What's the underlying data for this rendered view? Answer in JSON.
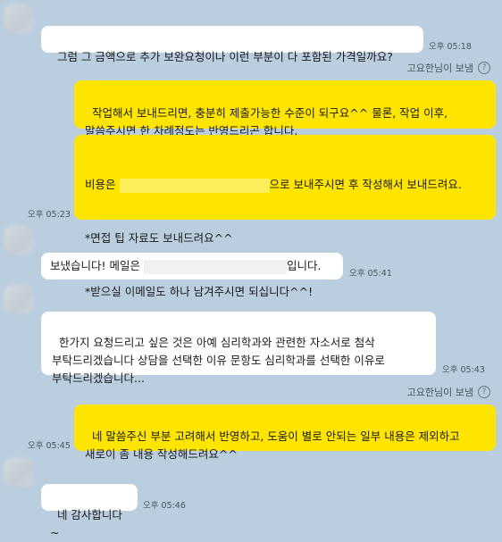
{
  "messages": {
    "m1": {
      "text": "그럼 그 금액으로 추가 보완요청이나 이런 부분이 다 포함된 가격일까요?",
      "time": "오후 05:18"
    },
    "m2_sender": {
      "name": "고요한님이 보냄",
      "icon": "?"
    },
    "m2": {
      "text": "작업해서 보내드리면, 충분히 제출가능한 수준이 되구요^^ 물론, 작업 이후, 말씀주시면 한 차례정도는 반영드리곤 합니다."
    },
    "m3": {
      "prefix": "비용은",
      "suffix": "으로 보내주시면 후 작성해서 보내드려요.",
      "line2": "*면접 팁 자료도 보내드려요^^",
      "line3": "*받으실 이메일도 하나 남겨주시면 되십니다^^!",
      "time": "오후 05:23"
    },
    "m4": {
      "prefix": "보냈습니다! 메일은",
      "suffix": "입니다.",
      "time": "오후 05:41"
    },
    "m5": {
      "text": "한가지 요청드리고 싶은 것은 아예 심리학과와 관련한 자소서로 첨삭 부탁드리겠습니다 상담을 선택한 이유 문항도 심리학과를 선택한 이유로 부탁드리겠습니다...",
      "time": "오후 05:43"
    },
    "m6_sender": {
      "name": "고요한님이 보냄",
      "icon": "?"
    },
    "m6": {
      "text": "네 말씀주신 부분 고려해서 반영하고, 도움이 별로 안되는 일부 내용은 제외하고 새로이 좀 내용 작성해드려요^^",
      "time": "오후 05:45"
    },
    "m7": {
      "text": "네 감사합니다~",
      "time": "오후 05:46"
    }
  },
  "colors": {
    "background": "#bacee0",
    "outgoing": "#fee500",
    "incoming": "#ffffff"
  }
}
